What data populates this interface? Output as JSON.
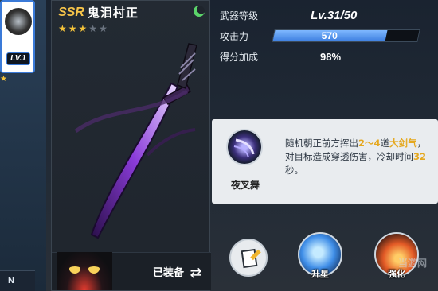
{
  "character": {
    "level_label": "LV.1",
    "star_glyph": "★",
    "bottom_tag": "N"
  },
  "weapon": {
    "rarity": "SSR",
    "name": "鬼泪村正",
    "stars_filled": 3,
    "stars_total": 5,
    "star_glyph": "★",
    "equipped_label": "已装备",
    "swap_icon": "swap-icon"
  },
  "stats": {
    "level_label": "武器等级",
    "level_value": "Lv.31/50",
    "attack_label": "攻击力",
    "attack_value": "570",
    "attack_fill_fraction": 0.78,
    "score_label": "得分加成",
    "score_value": "98%"
  },
  "skill": {
    "name": "夜叉舞",
    "desc_parts": [
      {
        "t": "随机朝正前方挥出",
        "hl": false
      },
      {
        "t": "2～4",
        "hl": true
      },
      {
        "t": "道",
        "hl": false
      },
      {
        "t": "大剑气",
        "hl": true
      },
      {
        "t": "，对目标造成穿透伤害，冷却时间",
        "hl": false
      },
      {
        "t": "32",
        "hl": true
      },
      {
        "t": "秒。",
        "hl": false
      }
    ]
  },
  "buttons": {
    "upstar_label": "升星",
    "forge_label": "强化"
  },
  "watermark": {
    "brand": "当游网"
  },
  "colors": {
    "accent_blue": "#3d7fe0",
    "highlight_gold": "#e5a81f",
    "rarity_gold": "#f6c44a"
  }
}
